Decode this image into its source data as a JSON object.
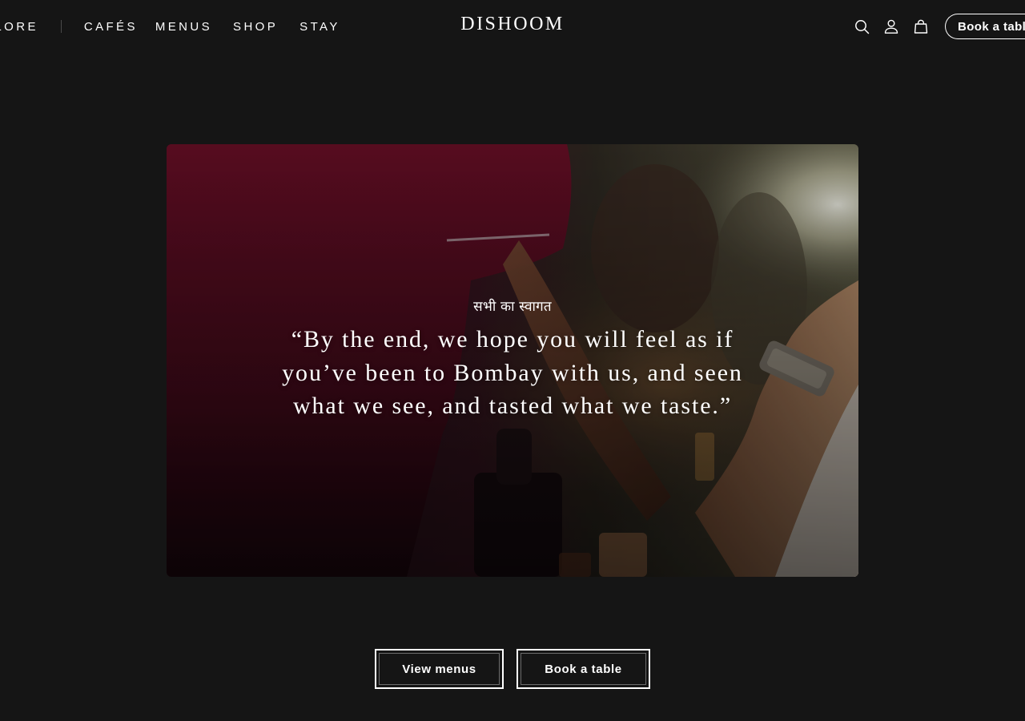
{
  "header": {
    "nav_left": [
      {
        "label": "PLORE"
      },
      {
        "label": "CAFÉS"
      },
      {
        "label": "MENUS"
      },
      {
        "label": "SHOP"
      },
      {
        "label": "STAY"
      }
    ],
    "logo": "DISHOOM",
    "icons": [
      "search-icon",
      "account-icon",
      "basket-icon"
    ],
    "book_label": "Book a table"
  },
  "hero": {
    "eyebrow": "सभी का स्वागत",
    "quote": "“By the end, we hope you will feel as if you’ve been to Bombay with us, and seen what we see, and tasted what we taste.”"
  },
  "cta": {
    "menus_label": "View menus",
    "book_label": "Book a table"
  },
  "colors": {
    "background": "#151515",
    "text": "#ffffff",
    "accent_red": "#7a1428"
  }
}
